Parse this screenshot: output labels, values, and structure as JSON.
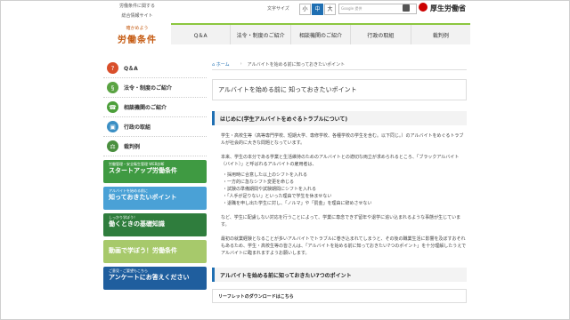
{
  "brand": {
    "line1": "労働条件に関する",
    "line2": "総合情報サイト",
    "catch": "確かめよう",
    "name": "労働条件"
  },
  "header": {
    "font_size_label": "文字サイズ",
    "sizes": [
      "小",
      "中",
      "大"
    ],
    "active_size": "中",
    "search_placeholder": "Google 提供",
    "ministry": "厚生労働省"
  },
  "nav": [
    "Q＆A",
    "法令・制度のご紹介",
    "相談機関のご紹介",
    "行政の取組",
    "裁判例"
  ],
  "sidebar": {
    "items": [
      {
        "label": "Q＆A",
        "color": "#d94f2b",
        "icon": "qa-icon"
      },
      {
        "label": "法令・制度のご紹介",
        "color": "#5aa342",
        "icon": "law-icon"
      },
      {
        "label": "相談機関のご紹介",
        "color": "#4c9f3a",
        "icon": "consult-icon"
      },
      {
        "label": "行政の取組",
        "color": "#3b8fc4",
        "icon": "admin-icon"
      },
      {
        "label": "裁判例",
        "color": "#4a8f3f",
        "icon": "court-icon"
      }
    ],
    "banners": [
      {
        "sub": "労働管理・安全衛生管理 WEB診断",
        "title": "スタートアップ労働条件",
        "color": "#3f9a42"
      },
      {
        "sub": "アルバイトを始める前に",
        "title": "知っておきたいポイント",
        "color": "#4aa1d6"
      },
      {
        "sub": "しっかり学ぼう！",
        "title": "働くときの基礎知識",
        "color": "#2f7d3d"
      },
      {
        "sub": "",
        "title": "動画で学ぼう！労働条件",
        "color": "#a7c96b"
      },
      {
        "sub": "ご意見・ご要望もこちら",
        "title": "アンケートにお答えください",
        "color": "#1f5e9e"
      }
    ]
  },
  "main": {
    "breadcrumb": {
      "home": "ホーム",
      "current": "アルバイトを始める前に知っておきたいポイント"
    },
    "page_title": "アルバイトを始める前に 知っておきたいポイント",
    "section1": "はじめに(学生アルバイトをめぐるトラブルについて)",
    "paras": [
      "学生・高校生等（高等専門学校、短期大学、専修学校、各種学校の学生を含む。以下同じ。）のアルバイトをめぐるトラブルが社会的に大きな問題となっています。",
      "本来、学生の本分である学業と生活維持のためのアルバイトとの適切な両立が求められるところ、「ブラックアルバイト（バイト）」と呼ばれるアルバイトの雇用者は、"
    ],
    "bullets": [
      "・採用時に合意した以上のシフトを入れる",
      "・一方的に急なシフト変更を命じる",
      "・試験の準備期間や試験期間にシフトを入れる",
      "・「人手が足りない」といった理由で学生を休ませない",
      "・退職を申し出た学生に対し、「ノルマ」や「罰金」を理由に辞めさせない"
    ],
    "para2": "など、学生に配慮しない対応を行うことによって、学業に専念できず留年や退学に追い込まれるような事態が生じています。",
    "para3": "最初の就業経験となることが多いアルバイトでトラブルに巻き込まれてしまうと、その後の職業生活に影響を及ぼすおそれもあるため、学生・高校生等の皆さんは、「アルバイトを始める前に知っておきたい7つのポイント」を十分理解したうえでアルバイトに臨まれますようお願いします。",
    "section2": "アルバイトを始める前に知っておきたい7つのポイント",
    "download": "リーフレットのダウンロードはこちら"
  }
}
